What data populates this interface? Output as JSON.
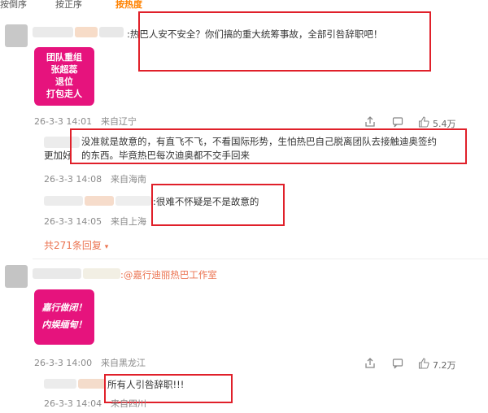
{
  "sort_tabs": [
    {
      "label": "按倒序",
      "active": false
    },
    {
      "label": "按正序",
      "active": false
    },
    {
      "label": "按热度",
      "active": true
    }
  ],
  "comment1": {
    "text": ":热巴人安不安全？你们搞的重大统筹事故，全部引咎辞职吧！",
    "card_lines": [
      "团队重组",
      "张超蕊",
      "退位",
      "打包走人"
    ],
    "time": "26-3-3 14:01",
    "location": "来自辽宁",
    "likes": "5.4万",
    "replies": [
      {
        "text_line1": "没准就是故意的，有直飞不飞，不看国际形势，生怕热巴自己脱离团队去接触迪奥签约",
        "text_line2_prefix": "更加好",
        "text_line2": "的东西。毕竟热巴每次迪奥都不交手回来",
        "time": "26-3-3 14:08",
        "location": "来自海南"
      },
      {
        "text": ":很难不怀疑是不是故意的",
        "time": "26-3-3 14:05",
        "location": "来自上海"
      }
    ],
    "total_replies": "共271条回复"
  },
  "comment2": {
    "mention": ":@嘉行迪丽热巴工作室",
    "card_lines": [
      "嘉行做闭！",
      "内娱缅甸！"
    ],
    "time": "26-3-3 14:00",
    "location": "来自黑龙江",
    "likes": "7.2万",
    "reply": {
      "text": "所有人引咎辞职!!!",
      "time": "26-3-3 14:04",
      "location": "来自四川"
    }
  },
  "colors": {
    "accent": "#ff8200",
    "highlight_box": "#e0202a",
    "card_pink": "#e6137d",
    "link": "#eb7350"
  },
  "icons": [
    "share-icon",
    "comment-icon",
    "like-icon",
    "chevron-down-icon"
  ]
}
